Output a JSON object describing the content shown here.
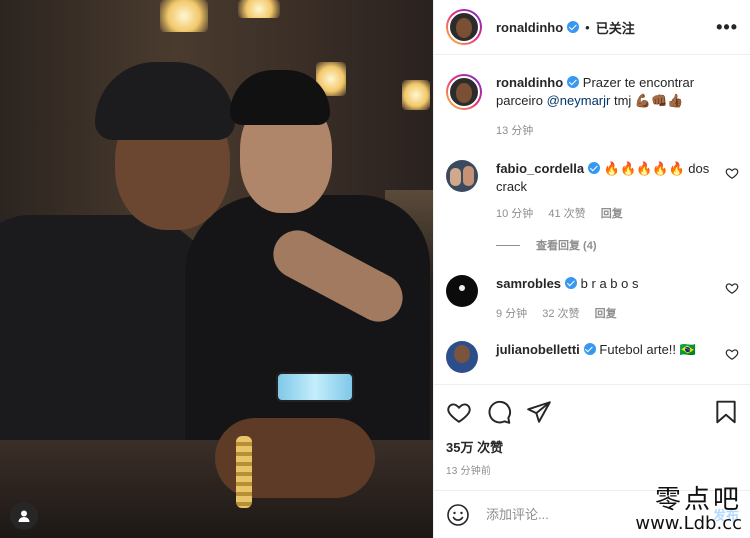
{
  "post": {
    "author": "ronaldinho",
    "follow_status": "已关注",
    "separator": "•",
    "more_label": "•••",
    "caption": {
      "username": "ronaldinho",
      "text": "Prazer te encontrar parceiro ",
      "mention": "@neymarjr",
      "tail": " tmj 💪🏾👊🏾👍🏾",
      "time": "13 分钟"
    },
    "comments": [
      {
        "username": "fabio_cordella",
        "text": "🔥🔥🔥🔥🔥 dos crack",
        "time": "10 分钟",
        "likes": "41 次赞",
        "reply": "回复",
        "view_replies": "查看回复 (4)"
      },
      {
        "username": "samrobles",
        "text": "b r a b o s",
        "time": "9 分钟",
        "likes": "32 次赞",
        "reply": "回复"
      },
      {
        "username": "julianobelletti",
        "text": "Futebol arte!! 🇧🇷"
      }
    ],
    "likes_count": "35万 次赞",
    "posted_time": "13 分钟前",
    "comment_placeholder": "添加评论...",
    "post_button": "发布"
  },
  "watermark": {
    "line1": "零点吧",
    "line2": "www.Ldb.cc"
  },
  "colors": {
    "verified": "#3897f0",
    "text": "#262626",
    "muted": "#8e8e8e",
    "border": "#efefef",
    "post_button_disabled": "#b3dbff"
  }
}
